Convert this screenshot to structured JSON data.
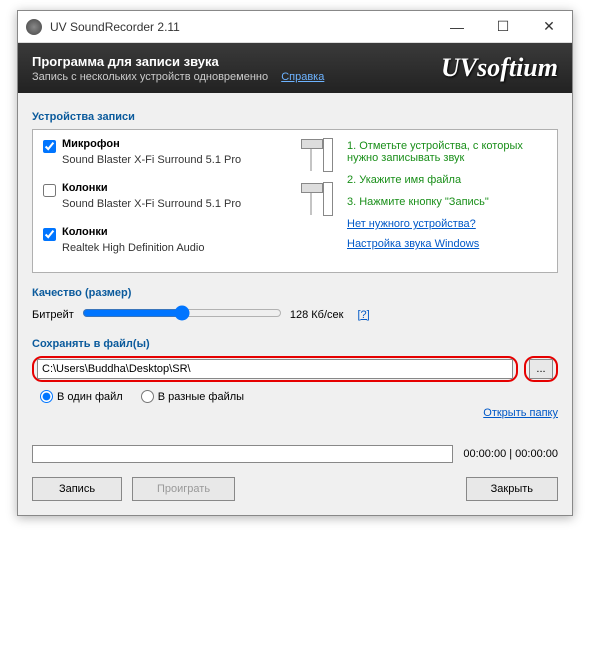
{
  "titlebar": {
    "text": "UV SoundRecorder 2.11"
  },
  "header": {
    "title": "Программа для записи звука",
    "subtitle": "Запись с нескольких устройств одновременно",
    "help_link": "Справка",
    "brand": "UVsoftium"
  },
  "devices": {
    "section_title": "Устройства записи",
    "items": [
      {
        "checked": true,
        "name": "Микрофон",
        "desc": "Sound Blaster X-Fi Surround 5.1 Pro"
      },
      {
        "checked": false,
        "name": "Колонки",
        "desc": "Sound Blaster X-Fi Surround 5.1 Pro"
      },
      {
        "checked": true,
        "name": "Колонки",
        "desc": "Realtek High Definition Audio"
      }
    ]
  },
  "hints": {
    "steps": [
      "1. Отметьте устройства, с которых нужно записывать звук",
      "2. Укажите имя файла",
      "3. Нажмите кнопку \"Запись\""
    ],
    "links": [
      "Нет нужного устройства?",
      "Настройка звука Windows"
    ]
  },
  "quality": {
    "section_title": "Качество (размер)",
    "label": "Битрейт",
    "value_text": "128 Кб/сек",
    "help": "[?]"
  },
  "save": {
    "section_title": "Сохранять в файл(ы)",
    "path": "C:\\Users\\Buddha\\Desktop\\SR\\",
    "browse": "...",
    "radio_single": "В один файл",
    "radio_multi": "В разные файлы",
    "open_folder": "Открыть папку"
  },
  "progress": {
    "time": "00:00:00 | 00:00:00"
  },
  "buttons": {
    "record": "Запись",
    "play": "Проиграть",
    "close": "Закрыть"
  }
}
